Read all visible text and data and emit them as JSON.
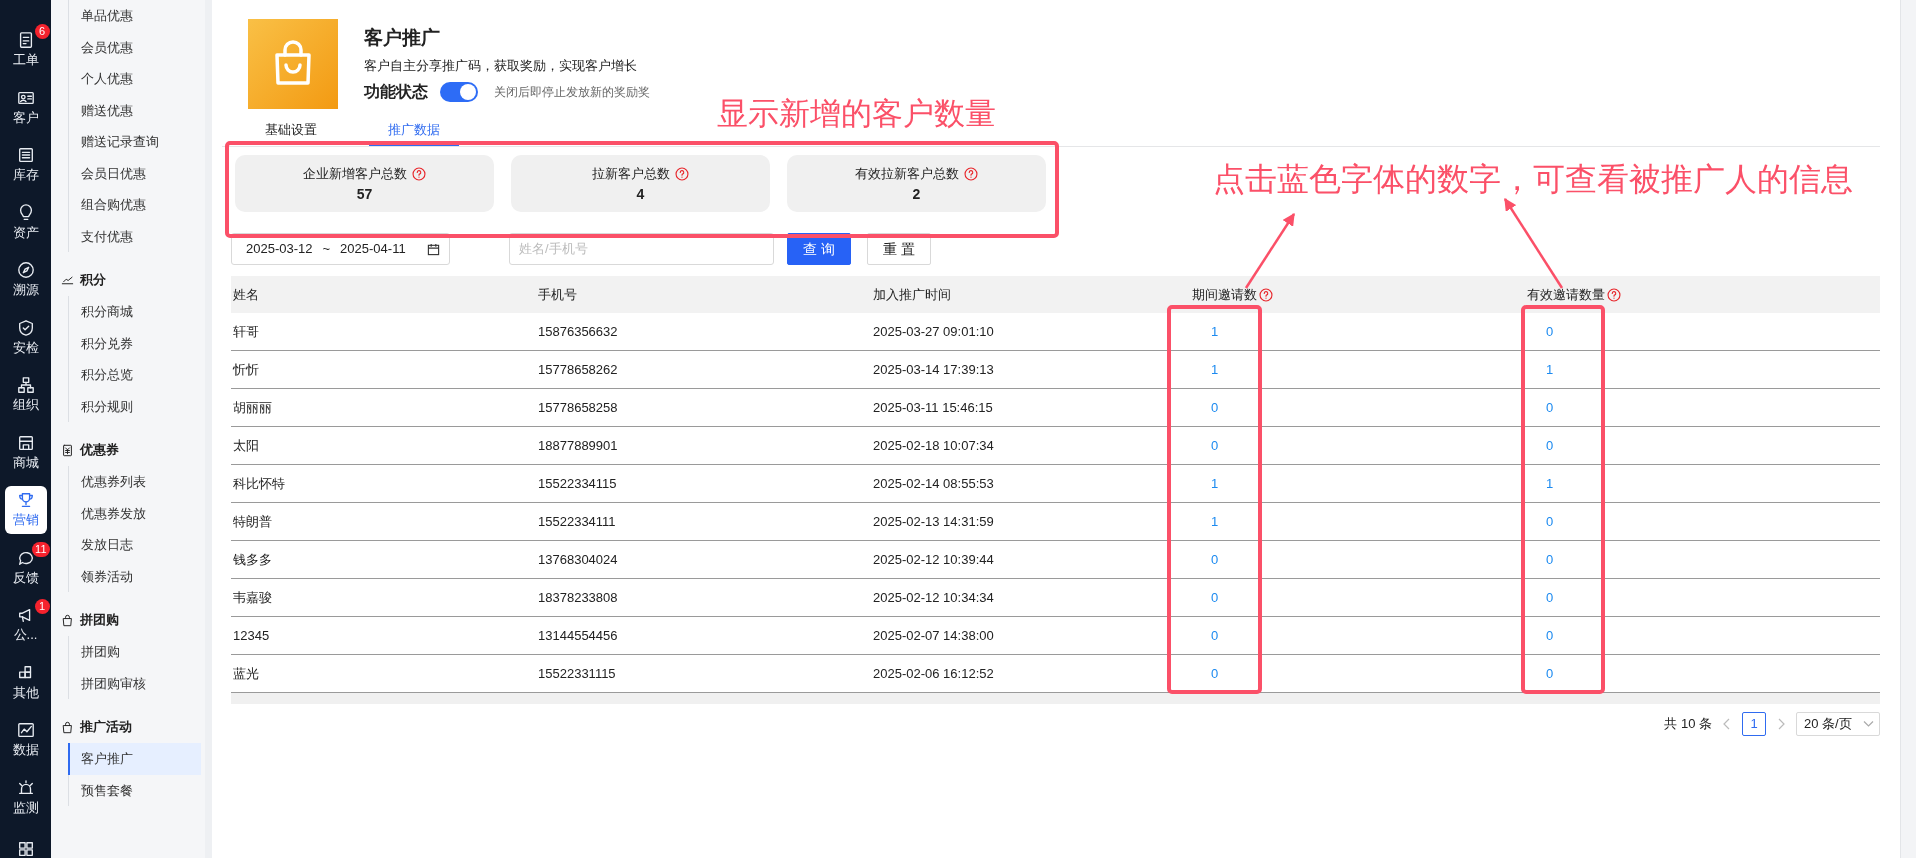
{
  "rail": [
    {
      "label": "工单",
      "badge": "6",
      "selected": false
    },
    {
      "label": "客户",
      "selected": false
    },
    {
      "label": "库存",
      "selected": false
    },
    {
      "label": "资产",
      "selected": false
    },
    {
      "label": "溯源",
      "selected": false
    },
    {
      "label": "安检",
      "selected": false
    },
    {
      "label": "组织",
      "selected": false
    },
    {
      "label": "商城",
      "selected": false
    },
    {
      "label": "营销",
      "selected": true
    },
    {
      "label": "反馈",
      "badge": "11",
      "selected": false
    },
    {
      "label": "公...",
      "badge": "1",
      "selected": false
    },
    {
      "label": "其他",
      "selected": false
    },
    {
      "label": "数据",
      "selected": false
    },
    {
      "label": "监测",
      "selected": false
    }
  ],
  "menu": [
    {
      "items": [
        {
          "label": "单品优惠",
          "selected": false
        },
        {
          "label": "会员优惠",
          "selected": false
        },
        {
          "label": "个人优惠",
          "selected": false
        },
        {
          "label": "赠送优惠",
          "selected": false
        },
        {
          "label": "赠送记录查询",
          "selected": false
        },
        {
          "label": "会员日优惠",
          "selected": false
        },
        {
          "label": "组合购优惠",
          "selected": false
        },
        {
          "label": "支付优惠",
          "selected": false
        }
      ]
    },
    {
      "title": "积分",
      "items": [
        {
          "label": "积分商城",
          "selected": false
        },
        {
          "label": "积分兑券",
          "selected": false
        },
        {
          "label": "积分总览",
          "selected": false
        },
        {
          "label": "积分规则",
          "selected": false
        }
      ]
    },
    {
      "title": "优惠券",
      "items": [
        {
          "label": "优惠券列表",
          "selected": false
        },
        {
          "label": "优惠券发放",
          "selected": false
        },
        {
          "label": "发放日志",
          "selected": false
        },
        {
          "label": "领券活动",
          "selected": false
        }
      ]
    },
    {
      "title": "拼团购",
      "items": [
        {
          "label": "拼团购",
          "selected": false
        },
        {
          "label": "拼团购审核",
          "selected": false
        }
      ]
    },
    {
      "title": "推广活动",
      "items": [
        {
          "label": "客户推广",
          "selected": true
        },
        {
          "label": "预售套餐",
          "selected": false
        }
      ]
    }
  ],
  "header": {
    "title": "客户推广",
    "description": "客户自主分享推广码，获取奖励，实现客户增长",
    "status_label": "功能状态",
    "enabled": true,
    "status_hint": "关闭后即停止发放新的奖励奖"
  },
  "tabs": [
    {
      "label": "基础设置",
      "selected": false
    },
    {
      "label": "推广数据",
      "selected": true
    }
  ],
  "stats": [
    {
      "label": "企业新增客户总数",
      "value": "57"
    },
    {
      "label": "拉新客户总数",
      "value": "4"
    },
    {
      "label": "有效拉新客户总数",
      "value": "2"
    }
  ],
  "filter": {
    "date_start": "2025-03-12",
    "separator": "~",
    "date_end": "2025-04-11",
    "search": {
      "placeholder": "姓名/手机号"
    },
    "buttons": [
      {
        "label": "查 询",
        "kind": "primary"
      },
      {
        "label": "重 置",
        "kind": "default"
      }
    ]
  },
  "table": {
    "columns": [
      {
        "label": "姓名",
        "kind": "text"
      },
      {
        "label": "手机号",
        "kind": "text"
      },
      {
        "label": "加入推广时间",
        "kind": "text"
      },
      {
        "label": "期间邀请数",
        "kind": "link"
      },
      {
        "label": "有效邀请数量",
        "kind": "link"
      }
    ],
    "rows": [
      [
        "轩哥",
        "15876356632",
        "2025-03-27 09:01:10",
        "1",
        "0"
      ],
      [
        "忻忻",
        "15778658262",
        "2025-03-14 17:39:13",
        "1",
        "1"
      ],
      [
        "胡丽丽",
        "15778658258",
        "2025-03-11 15:46:15",
        "0",
        "0"
      ],
      [
        "太阳",
        "18877889901",
        "2025-02-18 10:07:34",
        "0",
        "0"
      ],
      [
        "科比怀特",
        "15522334115",
        "2025-02-14 08:55:53",
        "1",
        "1"
      ],
      [
        "特朗普",
        "15522334111",
        "2025-02-13 14:31:59",
        "1",
        "0"
      ],
      [
        "钱多多",
        "13768304024",
        "2025-02-12 10:39:44",
        "0",
        "0"
      ],
      [
        "韦嘉骏",
        "18378233808",
        "2025-02-12 10:34:34",
        "0",
        "0"
      ],
      [
        "12345",
        "13144554456",
        "2025-02-07 14:38:00",
        "0",
        "0"
      ],
      [
        "蓝光",
        "15522331115",
        "2025-02-06 16:12:52",
        "0",
        "0"
      ]
    ]
  },
  "pagination": {
    "total": "共 10 条",
    "pages": [
      {
        "label": "1",
        "selected": true
      }
    ],
    "page_size": "20 条/页"
  },
  "annotations": [
    {
      "text": "显示新增的客户数量"
    },
    {
      "text": "点击蓝色字体的数字，可查看被推广人的信息"
    }
  ]
}
